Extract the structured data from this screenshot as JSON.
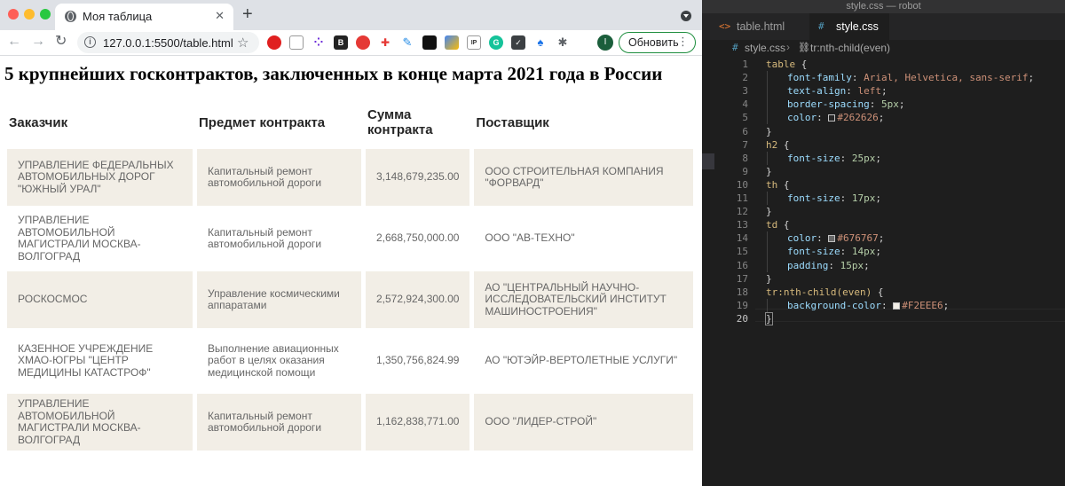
{
  "browser": {
    "tab_title": "Моя таблица",
    "tab_close": "✕",
    "new_tab": "+",
    "url": "127.0.0.1:5500/table.html",
    "profile_initial": "I",
    "update_label": "Обновить",
    "menu_dots": "⋮"
  },
  "page": {
    "heading": "5 крупнейших госконтрактов, заключенных в конце марта 2021 года в России",
    "columns": [
      "Заказчик",
      "Предмет контракта",
      "Сумма контракта",
      "Поставщик"
    ],
    "rows": [
      [
        "УПРАВЛЕНИЕ ФЕДЕРАЛЬНЫХ АВТОМОБИЛЬНЫХ ДОРОГ \"ЮЖНЫЙ УРАЛ\"",
        "Капитальный ремонт автомобильной дороги",
        "3,148,679,235.00",
        "ООО СТРОИТЕЛЬНАЯ КОМПАНИЯ \"ФОРВАРД\""
      ],
      [
        "УПРАВЛЕНИЕ АВТОМОБИЛЬНОЙ МАГИСТРАЛИ МОСКВА-ВОЛГОГРАД",
        "Капитальный ремонт автомобильной дороги",
        "2,668,750,000.00",
        "ООО \"АВ-ТЕХНО\""
      ],
      [
        "РОСКОСМОС",
        "Управление космическими аппаратами",
        "2,572,924,300.00",
        "АО \"ЦЕНТРАЛЬНЫЙ НАУЧНО-ИССЛЕДОВАТЕЛЬСКИЙ ИНСТИТУТ МАШИНОСТРОЕНИЯ\""
      ],
      [
        "КАЗЕННОЕ УЧРЕЖДЕНИЕ ХМАО-ЮГРЫ \"ЦЕНТР МЕДИЦИНЫ КАТАСТРОФ\"",
        "Выполнение авиационных работ в целях оказания медицинской помощи",
        "1,350,756,824.99",
        "АО \"ЮТЭЙР-ВЕРТОЛЕТНЫЕ УСЛУГИ\""
      ],
      [
        "УПРАВЛЕНИЕ АВТОМОБИЛЬНОЙ МАГИСТРАЛИ МОСКВА-ВОЛГОГРАД",
        "Капитальный ремонт автомобильной дороги",
        "1,162,838,771.00",
        "ООО \"ЛИДЕР-СТРОЙ\""
      ]
    ],
    "even_row_color": "#F2EEE6"
  },
  "editor": {
    "window_title": "style.css — robot",
    "tabs": [
      {
        "icon": "<>",
        "label": "table.html"
      },
      {
        "icon": "#",
        "label": "style.css"
      }
    ],
    "breadcrumb": {
      "file": "style.css",
      "selector": "tr:nth-child(even)"
    },
    "code": [
      {
        "n": "1",
        "selector": "table",
        "open": " {"
      },
      {
        "n": "2",
        "prop": "font-family",
        "value": "Arial, Helvetica, sans-serif"
      },
      {
        "n": "3",
        "prop": "text-align",
        "value": "left"
      },
      {
        "n": "4",
        "prop": "border-spacing",
        "value": "5px"
      },
      {
        "n": "5",
        "prop": "color",
        "value": "#262626",
        "swatch": "#262626"
      },
      {
        "n": "6",
        "close": "}"
      },
      {
        "n": "7",
        "selector": "h2",
        "open": " {"
      },
      {
        "n": "8",
        "prop": "font-size",
        "value": "25px"
      },
      {
        "n": "9",
        "close": "}"
      },
      {
        "n": "10",
        "selector": "th",
        "open": " {"
      },
      {
        "n": "11",
        "prop": "font-size",
        "value": "17px"
      },
      {
        "n": "12",
        "close": "}"
      },
      {
        "n": "13",
        "selector": "td",
        "open": " {"
      },
      {
        "n": "14",
        "prop": "color",
        "value": "#676767",
        "swatch": "#676767"
      },
      {
        "n": "15",
        "prop": "font-size",
        "value": "14px"
      },
      {
        "n": "16",
        "prop": "padding",
        "value": "15px"
      },
      {
        "n": "17",
        "close": "}"
      },
      {
        "n": "18",
        "selector": "tr:nth-child(even)",
        "open": " {"
      },
      {
        "n": "19",
        "prop": "background-color",
        "value": "#F2EEE6",
        "swatch": "#F2EEE6"
      },
      {
        "n": "20",
        "close": "}"
      }
    ],
    "current_line": "20"
  }
}
